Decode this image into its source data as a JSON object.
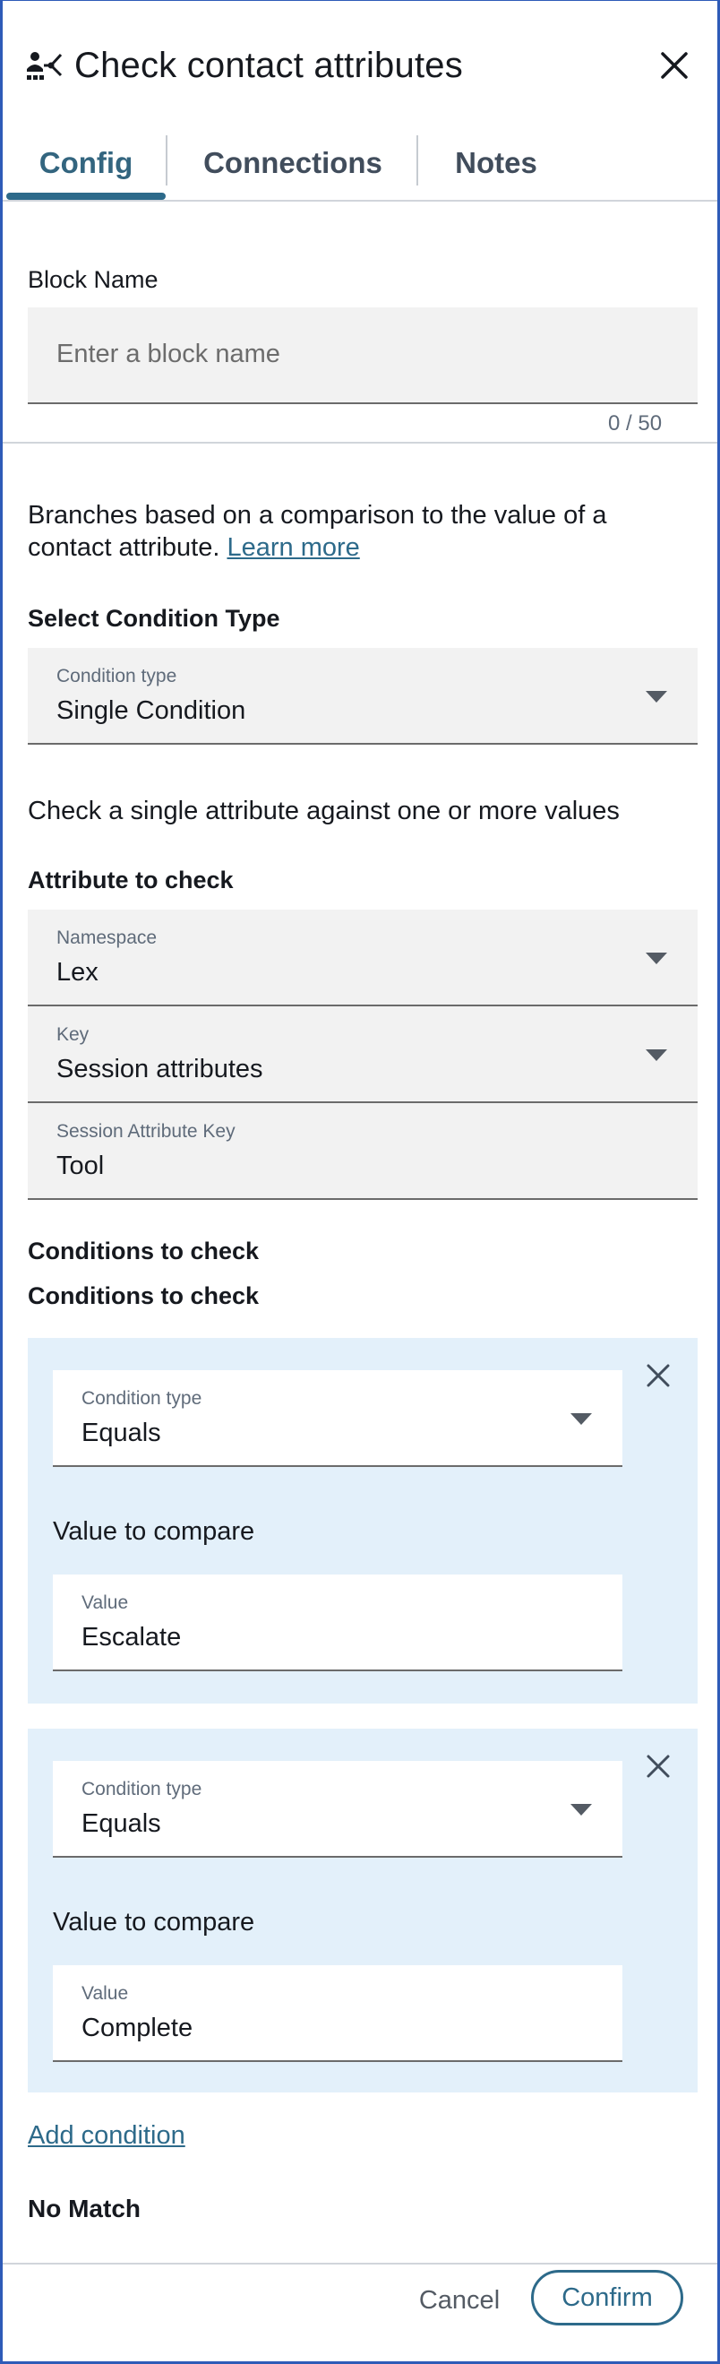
{
  "header": {
    "title": "Check contact attributes",
    "icon": "contact-attributes-icon",
    "close_icon": "close-icon"
  },
  "tabs": [
    {
      "label": "Config",
      "active": true
    },
    {
      "label": "Connections",
      "active": false
    },
    {
      "label": "Notes",
      "active": false
    }
  ],
  "block_name": {
    "label": "Block Name",
    "placeholder": "Enter a block name",
    "value": "",
    "counter": "0 / 50"
  },
  "description": {
    "text": "Branches based on a comparison to the value of a contact attribute.",
    "link": "Learn more"
  },
  "condition_type_section": {
    "heading": "Select Condition Type",
    "field_label": "Condition type",
    "value": "Single Condition",
    "help": "Check a single attribute against one or more values"
  },
  "attribute": {
    "heading": "Attribute to check",
    "namespace_label": "Namespace",
    "namespace_value": "Lex",
    "key_label": "Key",
    "key_value": "Session attributes",
    "session_key_label": "Session Attribute Key",
    "session_key_value": "Tool"
  },
  "conditions": {
    "heading1": "Conditions to check",
    "heading2": "Conditions to check",
    "items": [
      {
        "type_label": "Condition type",
        "type_value": "Equals",
        "compare_label": "Value to compare",
        "value_label": "Value",
        "value": "Escalate"
      },
      {
        "type_label": "Condition type",
        "type_value": "Equals",
        "compare_label": "Value to compare",
        "value_label": "Value",
        "value": "Complete"
      }
    ],
    "add_label": "Add condition"
  },
  "no_match": "No Match",
  "footer": {
    "cancel": "Cancel",
    "confirm": "Confirm"
  },
  "colors": {
    "accent": "#2d6a8a",
    "card_bg": "#e3f0fa",
    "border": "#2e5bb8"
  }
}
